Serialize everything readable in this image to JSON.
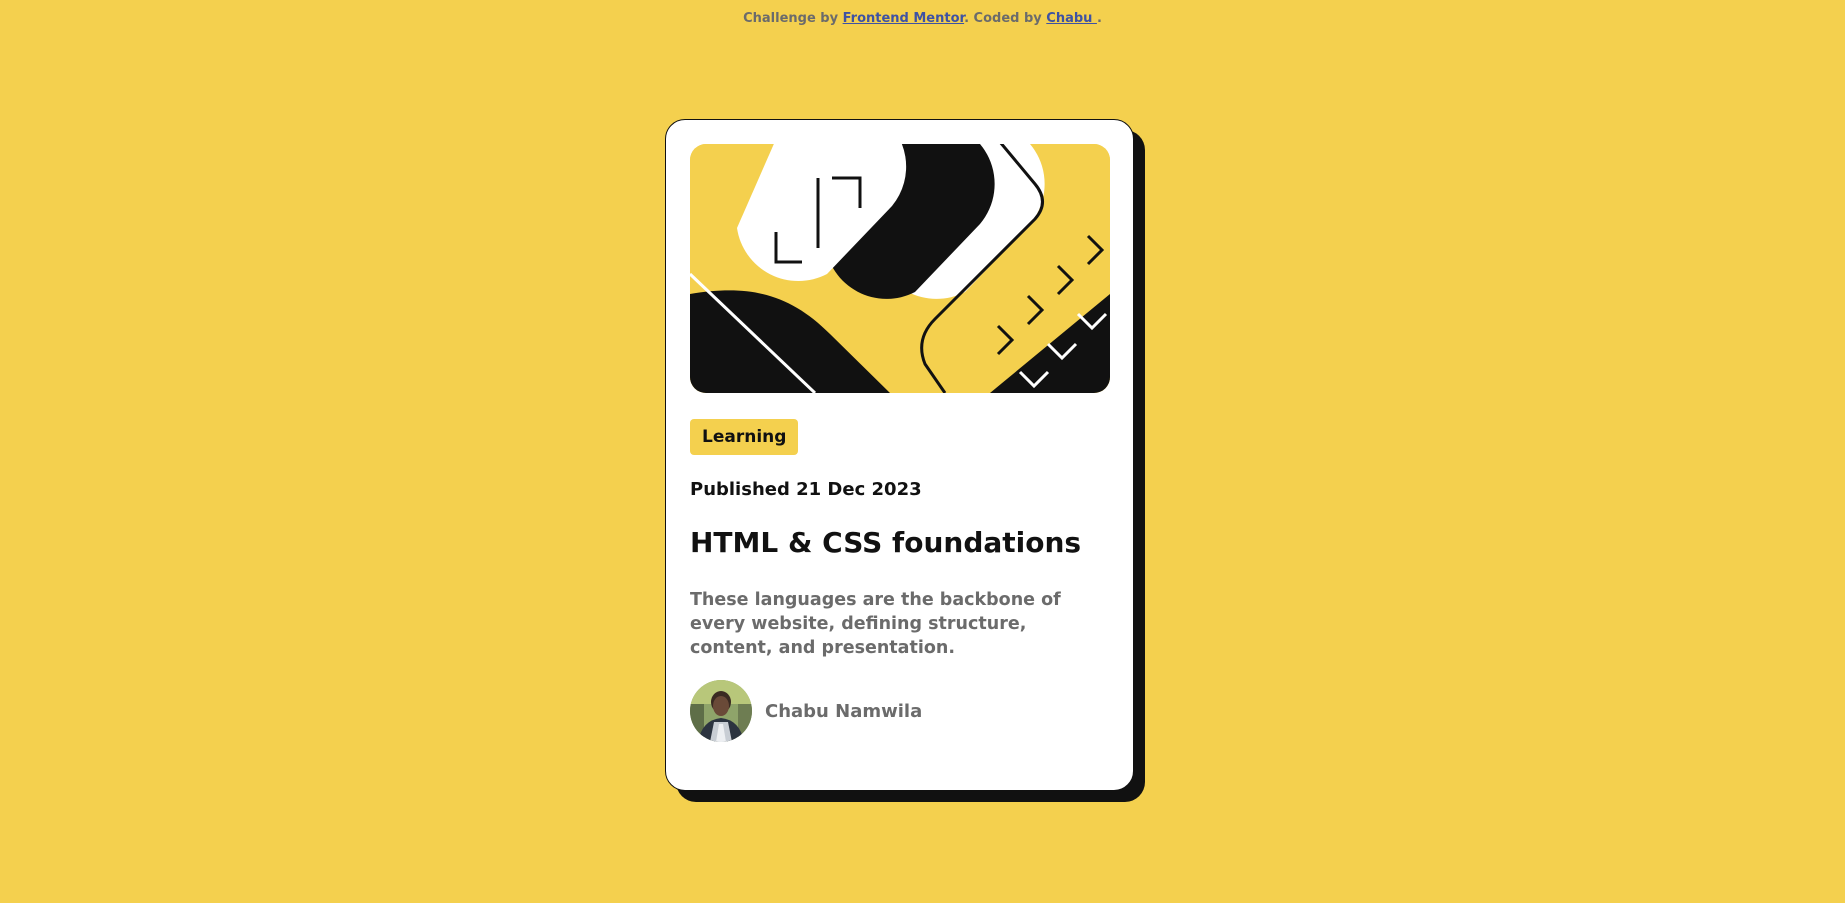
{
  "attribution": {
    "prefix": "Challenge by ",
    "link1": "Frontend Mentor",
    "middle": ". Coded by ",
    "link2": "Chabu ",
    "suffix": "."
  },
  "card": {
    "tag": "Learning",
    "published": "Published 21 Dec 2023",
    "title": "HTML & CSS foundations",
    "description": "These languages are the backbone of every website, defining structure, content, and presentation.",
    "author": {
      "name": "Chabu Namwila"
    }
  },
  "colors": {
    "background": "#F4D04E",
    "card": "#FFFFFF",
    "ink": "#111111",
    "muted": "#6B6B6B",
    "link": "#3E52A3"
  },
  "icons": {
    "hero": "html-css-illustration",
    "avatar": "author-avatar"
  }
}
